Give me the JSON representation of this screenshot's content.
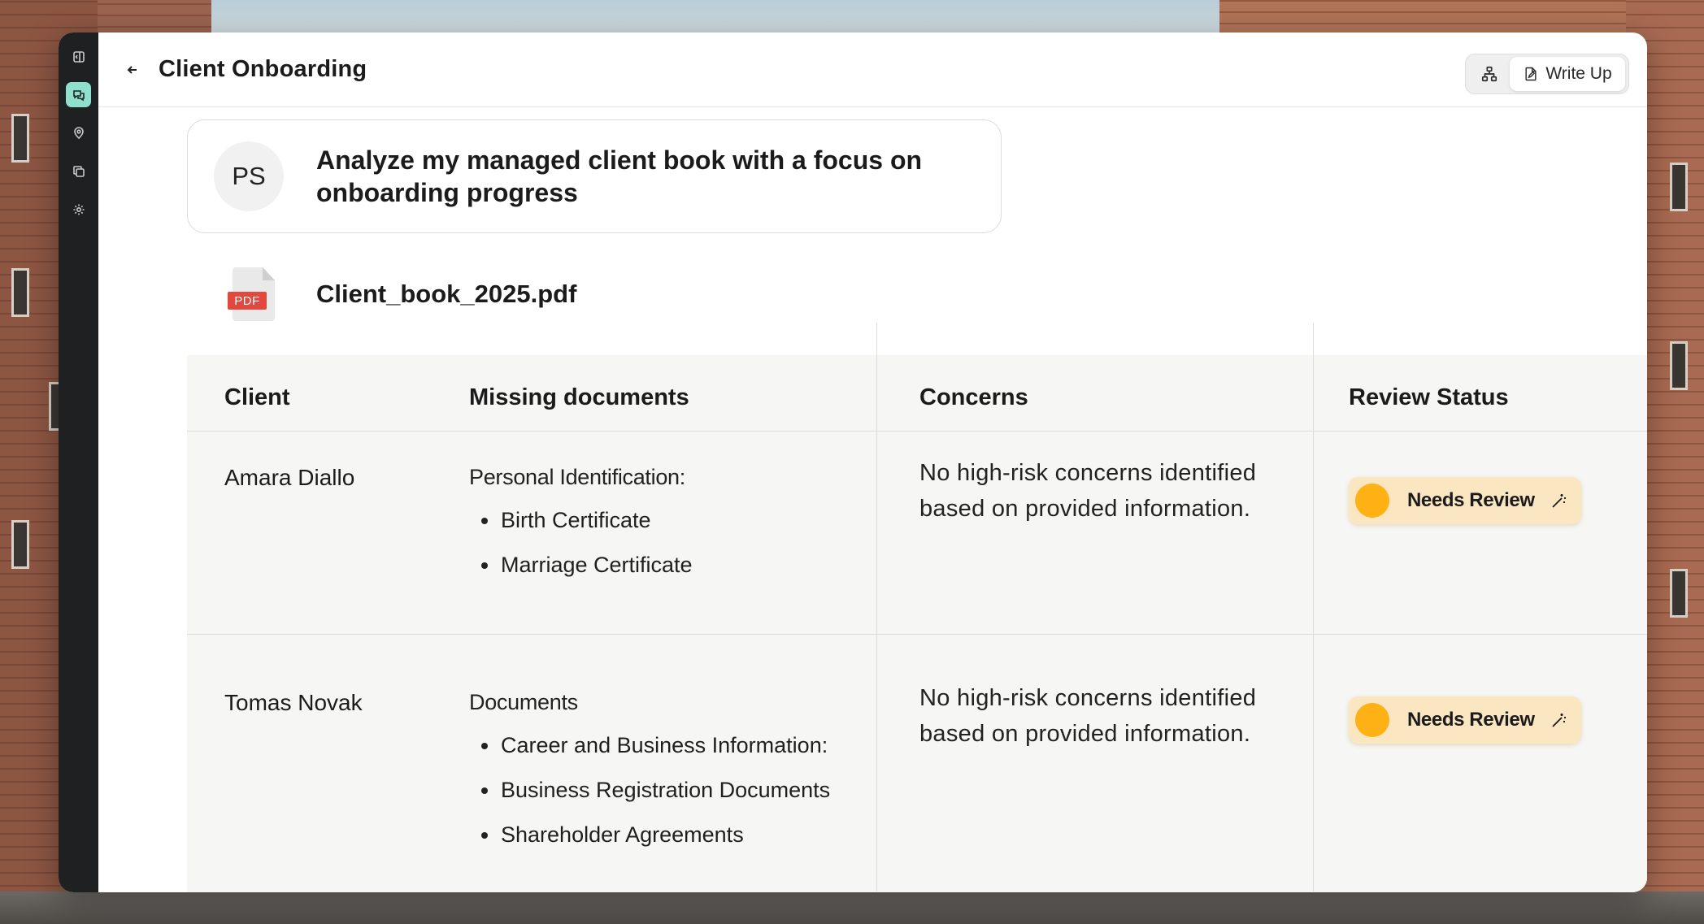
{
  "header": {
    "title": "Client Onboarding",
    "write_up_label": "Write Up"
  },
  "prompt": {
    "avatar_initials": "PS",
    "text": "Analyze my managed client book with a focus on onboarding progress"
  },
  "file": {
    "icon_tag": "PDF",
    "name": "Client_book_2025.pdf"
  },
  "table": {
    "headers": [
      "Client",
      "Missing documents",
      "Concerns",
      "Review Status"
    ],
    "rows": [
      {
        "client": "Amara Diallo",
        "doc_group": "Personal Identification:",
        "docs": [
          "Birth Certificate",
          "Marriage Certificate"
        ],
        "concern": "No high-risk concerns identified based on provided information.",
        "status": "Needs Review"
      },
      {
        "client": "Tomas Novak",
        "doc_group": "Documents",
        "docs": [
          "Career and Business Information:",
          "Business Registration Documents",
          "Shareholder Agreements"
        ],
        "concern": "No high-risk concerns identified based on provided information.",
        "status": "Needs Review"
      }
    ]
  },
  "colors": {
    "rail": "#1f2021",
    "rail_active": "#8fe0cc",
    "status_bg": "#fbe6c2",
    "status_dot": "#fdb114",
    "pdf_tag": "#e2483d"
  },
  "icons": {
    "rail": [
      "sidebar-toggle-icon",
      "chat-icon",
      "location-pin-icon",
      "copy-icon",
      "settings-icon"
    ],
    "toolbar": [
      "hierarchy-icon",
      "document-edit-icon"
    ],
    "status": "magic-wand-icon"
  }
}
